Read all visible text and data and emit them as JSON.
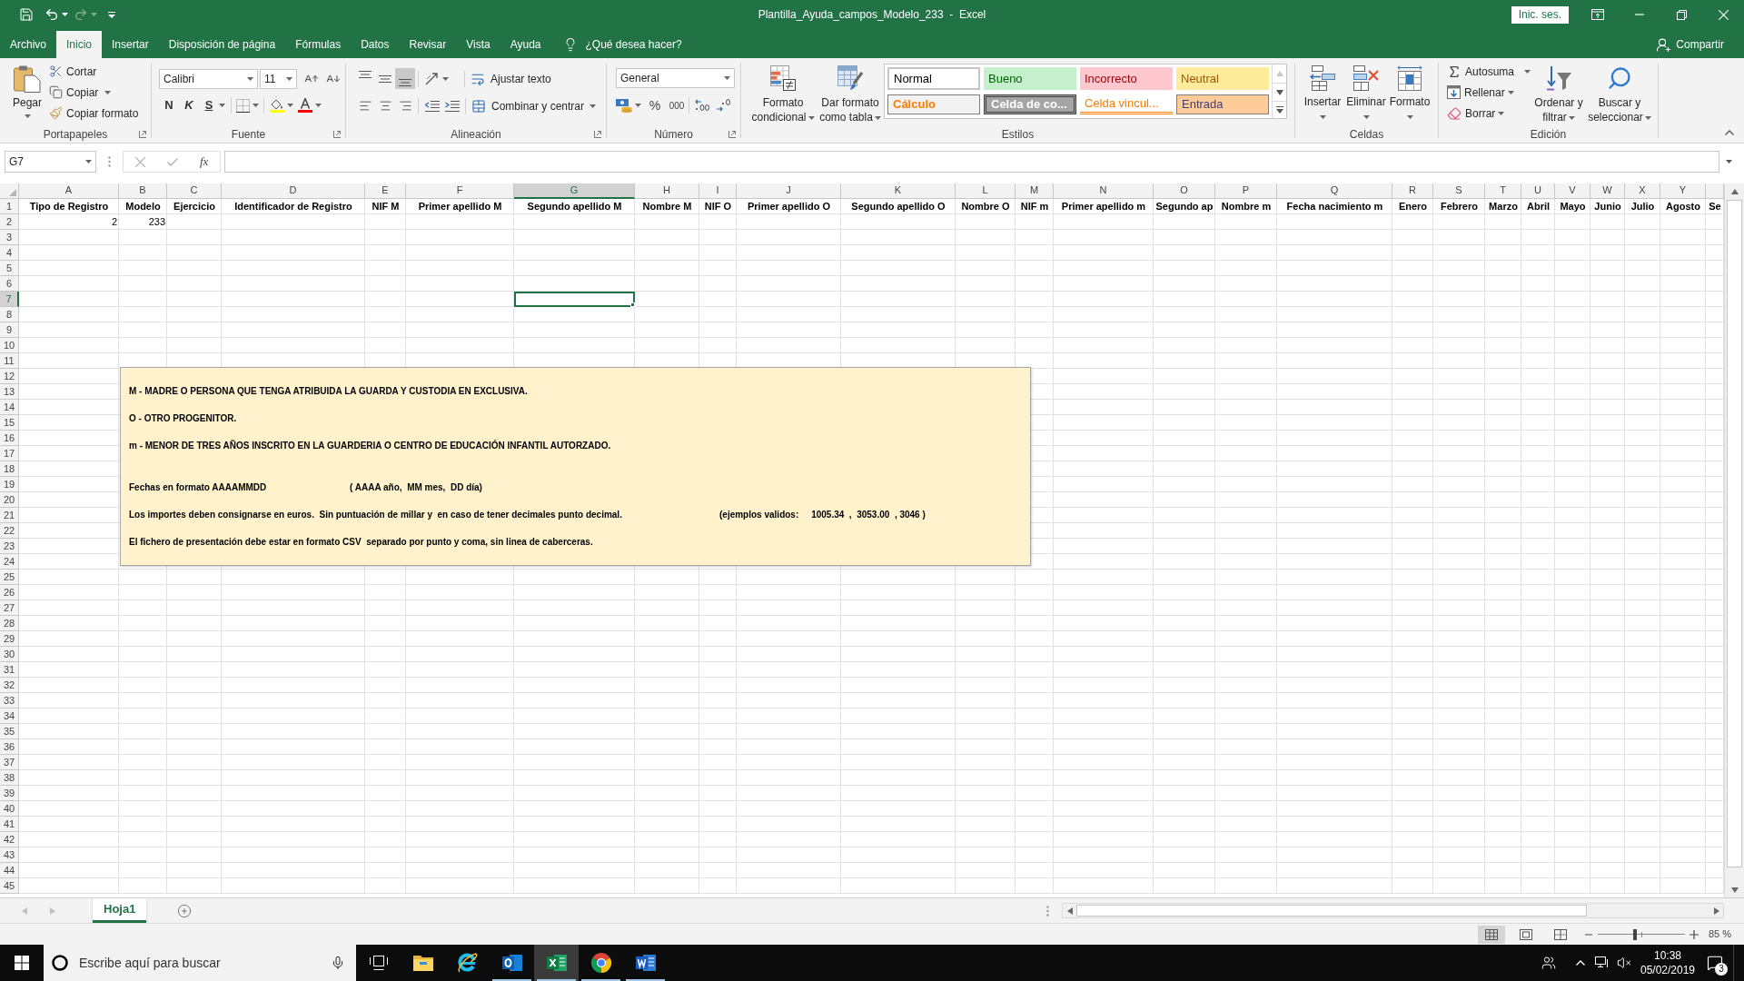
{
  "window": {
    "title": "Plantilla_Ayuda_campos_Modelo_233  -  Excel",
    "sign_in": "Inic. ses."
  },
  "quick_access": [
    {
      "kind": "save",
      "disabled": false
    },
    {
      "kind": "undo",
      "disabled": false
    },
    {
      "kind": "redo",
      "disabled": true
    },
    {
      "kind": "customize",
      "disabled": false
    }
  ],
  "tabs": [
    {
      "label": "Archivo",
      "selected": false
    },
    {
      "label": "Inicio",
      "selected": true
    },
    {
      "label": "Insertar",
      "selected": false
    },
    {
      "label": "Disposición de página",
      "selected": false
    },
    {
      "label": "Fórmulas",
      "selected": false
    },
    {
      "label": "Datos",
      "selected": false
    },
    {
      "label": "Revisar",
      "selected": false
    },
    {
      "label": "Vista",
      "selected": false
    },
    {
      "label": "Ayuda",
      "selected": false
    }
  ],
  "tell_me": "¿Qué desea hacer?",
  "share": "Compartir",
  "ribbon": {
    "clipboard": {
      "label": "Portapapeles",
      "paste": "Pegar",
      "actions": [
        {
          "kind": "cut",
          "label": "Cortar"
        },
        {
          "kind": "copy",
          "label": "Copiar"
        },
        {
          "kind": "format_painter",
          "label": "Copiar formato"
        }
      ]
    },
    "font": {
      "label": "Fuente",
      "name": "Calibri",
      "size": "11",
      "styles": [
        {
          "kind": "bold",
          "label": "N"
        },
        {
          "kind": "italic",
          "label": "K"
        },
        {
          "kind": "underline",
          "label": "S"
        }
      ]
    },
    "alignment": {
      "label": "Alineación",
      "vertical_align": [
        {
          "selected": false
        },
        {
          "selected": false
        },
        {
          "selected": true
        }
      ],
      "wrap": "Ajustar texto",
      "merge": "Combinar y centrar"
    },
    "number": {
      "label": "Número",
      "format": "General",
      "percent": "%",
      "thousands": "000"
    },
    "styles": {
      "label": "Estilos",
      "conditional": [
        "Formato",
        "condicional"
      ],
      "as_table": [
        "Dar formato",
        "como tabla"
      ],
      "gallery": [
        {
          "kind": "normal",
          "label": "Normal"
        },
        {
          "kind": "good",
          "label": "Bueno"
        },
        {
          "kind": "bad",
          "label": "Incorrecto"
        },
        {
          "kind": "neutral",
          "label": "Neutral"
        },
        {
          "kind": "calculation",
          "label": "Cálculo"
        },
        {
          "kind": "check",
          "label": "Celda de co..."
        },
        {
          "kind": "linked",
          "label": "Celda vincul..."
        },
        {
          "kind": "input",
          "label": "Entrada"
        }
      ]
    },
    "cells": {
      "label": "Celdas",
      "actions": [
        {
          "kind": "insert",
          "label": "Insertar"
        },
        {
          "kind": "delete",
          "label": "Eliminar"
        },
        {
          "kind": "format",
          "label": "Formato"
        }
      ]
    },
    "editing": {
      "label": "Edición",
      "actions": [
        {
          "kind": "autosum",
          "label": "Autosuma"
        },
        {
          "kind": "fill",
          "label": "Rellenar"
        },
        {
          "kind": "clear",
          "label": "Borrar"
        }
      ],
      "tools": [
        {
          "kind": "sort",
          "lines": [
            "Ordenar y",
            "filtrar"
          ]
        },
        {
          "kind": "find",
          "lines": [
            "Buscar y",
            "seleccionar"
          ]
        }
      ]
    }
  },
  "formula_bar": {
    "name_box": "G7",
    "function_label": "fx"
  },
  "sheet": {
    "columns": [
      {
        "letter": "A",
        "selected": false
      },
      {
        "letter": "B",
        "selected": false
      },
      {
        "letter": "C",
        "selected": false
      },
      {
        "letter": "D",
        "selected": false
      },
      {
        "letter": "E",
        "selected": false
      },
      {
        "letter": "F",
        "selected": false
      },
      {
        "letter": "G",
        "selected": true
      },
      {
        "letter": "H",
        "selected": false
      },
      {
        "letter": "I",
        "selected": false
      },
      {
        "letter": "J",
        "selected": false
      },
      {
        "letter": "K",
        "selected": false
      },
      {
        "letter": "L",
        "selected": false
      },
      {
        "letter": "M",
        "selected": false
      },
      {
        "letter": "N",
        "selected": false
      },
      {
        "letter": "O",
        "selected": false
      },
      {
        "letter": "P",
        "selected": false
      },
      {
        "letter": "Q",
        "selected": false
      },
      {
        "letter": "R",
        "selected": false
      },
      {
        "letter": "S",
        "selected": false
      },
      {
        "letter": "T",
        "selected": false
      },
      {
        "letter": "U",
        "selected": false
      },
      {
        "letter": "V",
        "selected": false
      },
      {
        "letter": "W",
        "selected": false
      },
      {
        "letter": "X",
        "selected": false
      },
      {
        "letter": "Y",
        "selected": false
      }
    ],
    "rows": [
      {
        "number": "1",
        "selected": false,
        "cells": [
          "Tipo de Registro",
          "Modelo",
          "Ejercicio",
          "Identificador de Registro",
          "NIF M",
          "Primer apellido M",
          "Segundo apellido M",
          "Nombre M",
          "NIF O",
          "Primer apellido O",
          "Segundo apellido O",
          "Nombre O",
          "NIF m",
          "Primer apellido m",
          "Segundo ap",
          "Nombre m",
          "Fecha nacimiento m",
          "Enero",
          "Febrero",
          "Marzo",
          "Abril",
          "Mayo",
          "Junio",
          "Julio",
          "Agosto",
          "Se"
        ]
      },
      {
        "number": "2",
        "selected": false,
        "cells": [
          "2",
          "233"
        ]
      },
      {
        "number": "3",
        "selected": false
      },
      {
        "number": "4",
        "selected": false
      },
      {
        "number": "5",
        "selected": false
      },
      {
        "number": "6",
        "selected": false
      },
      {
        "number": "7",
        "selected": true
      },
      {
        "number": "8",
        "selected": false
      },
      {
        "number": "9",
        "selected": false
      },
      {
        "number": "10",
        "selected": false
      },
      {
        "number": "11",
        "selected": false
      },
      {
        "number": "12",
        "selected": false
      },
      {
        "number": "13",
        "selected": false
      },
      {
        "number": "14",
        "selected": false
      },
      {
        "number": "15",
        "selected": false
      },
      {
        "number": "16",
        "selected": false
      },
      {
        "number": "17",
        "selected": false
      },
      {
        "number": "18",
        "selected": false
      },
      {
        "number": "19",
        "selected": false
      },
      {
        "number": "20",
        "selected": false
      },
      {
        "number": "21",
        "selected": false
      },
      {
        "number": "22",
        "selected": false
      },
      {
        "number": "23",
        "selected": false
      },
      {
        "number": "24",
        "selected": false
      },
      {
        "number": "25",
        "selected": false
      },
      {
        "number": "26",
        "selected": false
      },
      {
        "number": "27",
        "selected": false
      },
      {
        "number": "28",
        "selected": false
      },
      {
        "number": "29",
        "selected": false
      },
      {
        "number": "30",
        "selected": false
      },
      {
        "number": "31",
        "selected": false
      },
      {
        "number": "32",
        "selected": false
      },
      {
        "number": "33",
        "selected": false
      },
      {
        "number": "34",
        "selected": false
      },
      {
        "number": "35",
        "selected": false
      },
      {
        "number": "36",
        "selected": false
      },
      {
        "number": "37",
        "selected": false
      },
      {
        "number": "38",
        "selected": false
      },
      {
        "number": "39",
        "selected": false
      },
      {
        "number": "40",
        "selected": false
      },
      {
        "number": "41",
        "selected": false
      },
      {
        "number": "42",
        "selected": false
      },
      {
        "number": "43",
        "selected": false
      },
      {
        "number": "44",
        "selected": false
      },
      {
        "number": "45",
        "selected": false
      }
    ]
  },
  "note_box": {
    "lines": [
      {
        "text": "M - MADRE O PERSONA QUE TENGA ATRIBUIDA LA GUARDA Y CUSTODIA EN EXCLUSIVA."
      },
      {
        "text": "O - OTRO PROGENITOR."
      },
      {
        "text": "m - MENOR DE TRES AÑOS INSCRITO EN LA GUARDERIA O CENTRO DE EDUCACIÓN INFANTIL AUTORZADO."
      },
      {
        "text": "Fechas en formato AAAAMMDD",
        "aside": "( AAAA año,  MM mes,  DD día)"
      },
      {
        "text": "Los importes deben consignarse en euros.  Sin puntuación de millar y  en caso de tener decimales punto decimal.",
        "aside": "(ejemplos validos:     1005.34  ,  3053.00  , 3046 )"
      },
      {
        "text": "El fichero de presentación debe estar en formato CSV  separado por punto y coma, sin linea de caberceras."
      }
    ]
  },
  "sheet_tabs": [
    {
      "label": "Hoja1",
      "selected": true
    }
  ],
  "status_bar": {
    "views": [
      {
        "kind": "normal",
        "selected": true
      },
      {
        "kind": "page_layout",
        "selected": false
      },
      {
        "kind": "page_break",
        "selected": false
      }
    ],
    "zoom": {
      "level": 0.43,
      "reading": "85 %"
    }
  },
  "taskbar": {
    "search_placeholder": "Escribe aquí para buscar",
    "apps": [
      {
        "kind": "task_view",
        "running": false,
        "selected": false
      },
      {
        "kind": "explorer",
        "running": false,
        "selected": false
      },
      {
        "kind": "ie",
        "running": false,
        "selected": false
      },
      {
        "kind": "outlook",
        "running": true,
        "selected": false
      },
      {
        "kind": "excel",
        "running": true,
        "selected": true
      },
      {
        "kind": "chrome",
        "running": true,
        "selected": false
      },
      {
        "kind": "word",
        "running": true,
        "selected": false
      }
    ],
    "time": "10:38",
    "date": "05/02/2019",
    "notifications": "3"
  }
}
